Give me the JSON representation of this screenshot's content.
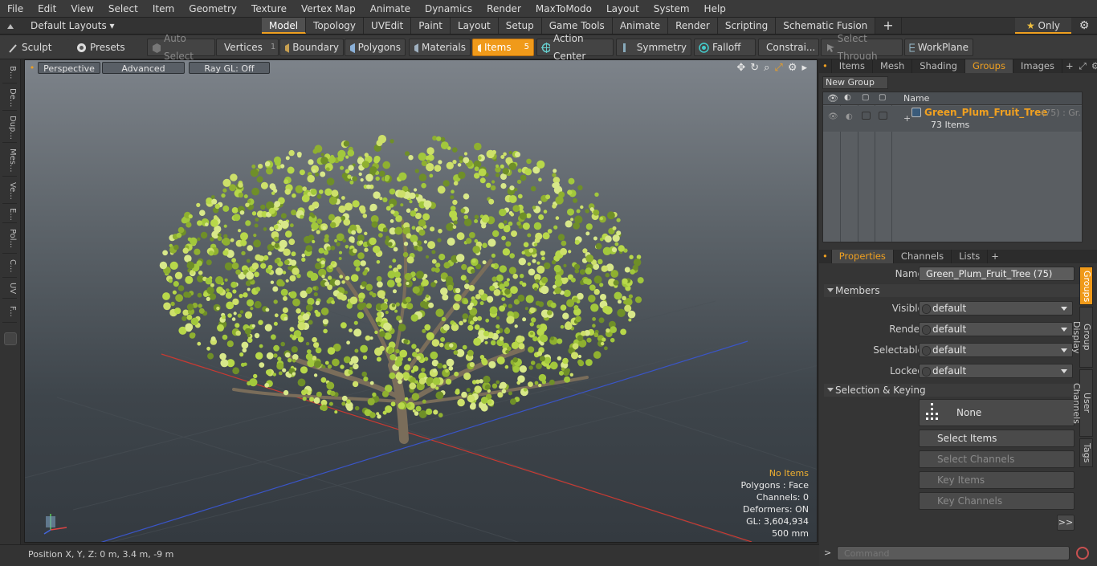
{
  "menu": [
    "File",
    "Edit",
    "View",
    "Select",
    "Item",
    "Geometry",
    "Texture",
    "Vertex Map",
    "Animate",
    "Dynamics",
    "Render",
    "MaxToModo",
    "Layout",
    "System",
    "Help"
  ],
  "layoutbar": {
    "layouts_label": "Default Layouts",
    "tabs": [
      "Model",
      "Topology",
      "UVEdit",
      "Paint",
      "Layout",
      "Setup",
      "Game Tools",
      "Animate",
      "Render",
      "Scripting",
      "Schematic Fusion"
    ],
    "active_tab": "Model",
    "only_label": "Only"
  },
  "toolbar": {
    "sculpt": "Sculpt",
    "presets": "Presets",
    "auto_select": "Auto Select",
    "vertices": "Vertices",
    "vertices_count": "1",
    "boundary": "Boundary",
    "polygons": "Polygons",
    "materials": "Materials",
    "items": "Items",
    "items_count": "5",
    "action_center": "Action Center",
    "symmetry": "Symmetry",
    "falloff": "Falloff",
    "constraints": "Constrai...",
    "select_through": "Select Through",
    "workplane": "WorkPlane"
  },
  "left_tabs": [
    "B...",
    "De...",
    "Dup...",
    "Mes...",
    "Ve...",
    "E...",
    "Pol...",
    "C...",
    "UV",
    "F..."
  ],
  "viewport": {
    "view_mode": "Perspective",
    "shading": "Advanced",
    "raygl": "Ray GL: Off",
    "info": {
      "selection": "No Items",
      "polygons": "Polygons : Face",
      "channels": "Channels: 0",
      "deformers": "Deformers: ON",
      "gl": "GL: 3,604,934",
      "scale": "500 mm"
    }
  },
  "statusbar": {
    "position": "Position X, Y, Z:   0 m, 3.4 m, -9 m"
  },
  "groups_panel": {
    "tabs": [
      "Items",
      "Mesh ...",
      "Shading",
      "Groups",
      "Images"
    ],
    "active_tab": "Groups",
    "new_group": "New Group",
    "column_name": "Name",
    "group_name": "Green_Plum_Fruit_Tree",
    "group_suffix": "(75) : Gr...",
    "group_count": "73 Items"
  },
  "properties_panel": {
    "tabs": [
      "Properties",
      "Channels",
      "Lists"
    ],
    "active_tab": "Properties",
    "name_label": "Name",
    "name_value": "Green_Plum_Fruit_Tree (75)",
    "members_section": "Members",
    "rows": [
      {
        "label": "Visible",
        "value": "default"
      },
      {
        "label": "Render",
        "value": "default"
      },
      {
        "label": "Selectable",
        "value": "default"
      },
      {
        "label": "Locked",
        "value": "default"
      }
    ],
    "selection_section": "Selection & Keying",
    "none_label": "None",
    "select_items": "Select Items",
    "select_channels": "Select Channels",
    "key_items": "Key Items",
    "key_channels": "Key Channels",
    "more": ">>",
    "side_tabs": [
      "Groups",
      "Group Display",
      "User Channels",
      "Tags"
    ]
  },
  "command": {
    "placeholder": "Command",
    "prompt": ">"
  },
  "colors": {
    "accent": "#f0a020",
    "panel": "#353535",
    "viewport_top": "#7d838a",
    "foliage": "#b8d84a",
    "trunk": "#7a6d5a"
  }
}
